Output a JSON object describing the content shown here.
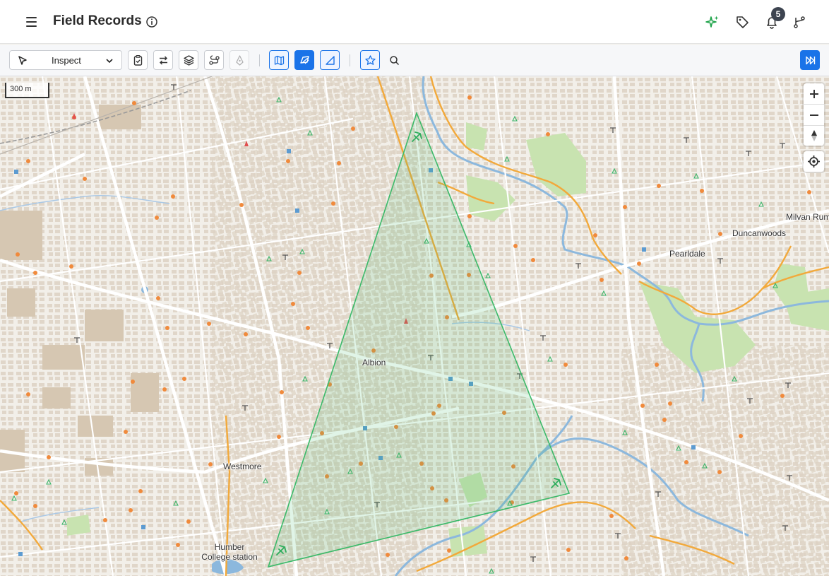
{
  "header": {
    "title": "Field Records",
    "notification_count": "5",
    "accent_color": "#1a73e8",
    "sparkle_color": "#1fa34a"
  },
  "toolbar": {
    "mode_value": "Inspect",
    "buttons": [
      "clipboard-check-icon",
      "swap-arrows-icon",
      "layers-icon",
      "route-icon",
      "pen-tool-icon",
      "map-icon",
      "draw-area-icon",
      "measure-angle-icon",
      "star-icon",
      "search-icon",
      "collapse-panel-icon"
    ]
  },
  "map": {
    "scale_label": "300 m",
    "places": {
      "albion": "Albion",
      "westmore": "Westmore",
      "humber_line1": "Humber",
      "humber_line2": "College station",
      "pearldale": "Pearldale",
      "duncanwoods": "Duncanwoods",
      "milvan": "Milvan Rum"
    },
    "selection_color": "#3cba6a",
    "water_color": "#8cb8dd",
    "park_color": "#c8e3b0",
    "major_road_color": "#f2a93b",
    "building_color": "#d9ccba"
  }
}
